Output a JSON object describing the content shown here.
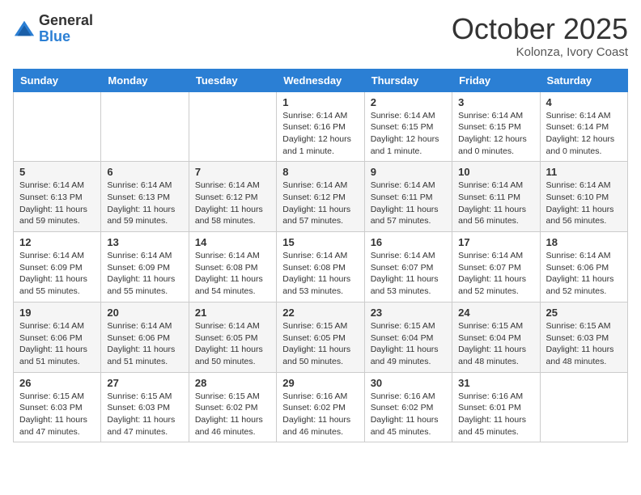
{
  "logo": {
    "general": "General",
    "blue": "Blue"
  },
  "title": "October 2025",
  "subtitle": "Kolonza, Ivory Coast",
  "days_of_week": [
    "Sunday",
    "Monday",
    "Tuesday",
    "Wednesday",
    "Thursday",
    "Friday",
    "Saturday"
  ],
  "weeks": [
    [
      {
        "day": "",
        "info": ""
      },
      {
        "day": "",
        "info": ""
      },
      {
        "day": "",
        "info": ""
      },
      {
        "day": "1",
        "info": "Sunrise: 6:14 AM\nSunset: 6:16 PM\nDaylight: 12 hours and 1 minute."
      },
      {
        "day": "2",
        "info": "Sunrise: 6:14 AM\nSunset: 6:15 PM\nDaylight: 12 hours and 1 minute."
      },
      {
        "day": "3",
        "info": "Sunrise: 6:14 AM\nSunset: 6:15 PM\nDaylight: 12 hours and 0 minutes."
      },
      {
        "day": "4",
        "info": "Sunrise: 6:14 AM\nSunset: 6:14 PM\nDaylight: 12 hours and 0 minutes."
      }
    ],
    [
      {
        "day": "5",
        "info": "Sunrise: 6:14 AM\nSunset: 6:13 PM\nDaylight: 11 hours and 59 minutes."
      },
      {
        "day": "6",
        "info": "Sunrise: 6:14 AM\nSunset: 6:13 PM\nDaylight: 11 hours and 59 minutes."
      },
      {
        "day": "7",
        "info": "Sunrise: 6:14 AM\nSunset: 6:12 PM\nDaylight: 11 hours and 58 minutes."
      },
      {
        "day": "8",
        "info": "Sunrise: 6:14 AM\nSunset: 6:12 PM\nDaylight: 11 hours and 57 minutes."
      },
      {
        "day": "9",
        "info": "Sunrise: 6:14 AM\nSunset: 6:11 PM\nDaylight: 11 hours and 57 minutes."
      },
      {
        "day": "10",
        "info": "Sunrise: 6:14 AM\nSunset: 6:11 PM\nDaylight: 11 hours and 56 minutes."
      },
      {
        "day": "11",
        "info": "Sunrise: 6:14 AM\nSunset: 6:10 PM\nDaylight: 11 hours and 56 minutes."
      }
    ],
    [
      {
        "day": "12",
        "info": "Sunrise: 6:14 AM\nSunset: 6:09 PM\nDaylight: 11 hours and 55 minutes."
      },
      {
        "day": "13",
        "info": "Sunrise: 6:14 AM\nSunset: 6:09 PM\nDaylight: 11 hours and 55 minutes."
      },
      {
        "day": "14",
        "info": "Sunrise: 6:14 AM\nSunset: 6:08 PM\nDaylight: 11 hours and 54 minutes."
      },
      {
        "day": "15",
        "info": "Sunrise: 6:14 AM\nSunset: 6:08 PM\nDaylight: 11 hours and 53 minutes."
      },
      {
        "day": "16",
        "info": "Sunrise: 6:14 AM\nSunset: 6:07 PM\nDaylight: 11 hours and 53 minutes."
      },
      {
        "day": "17",
        "info": "Sunrise: 6:14 AM\nSunset: 6:07 PM\nDaylight: 11 hours and 52 minutes."
      },
      {
        "day": "18",
        "info": "Sunrise: 6:14 AM\nSunset: 6:06 PM\nDaylight: 11 hours and 52 minutes."
      }
    ],
    [
      {
        "day": "19",
        "info": "Sunrise: 6:14 AM\nSunset: 6:06 PM\nDaylight: 11 hours and 51 minutes."
      },
      {
        "day": "20",
        "info": "Sunrise: 6:14 AM\nSunset: 6:06 PM\nDaylight: 11 hours and 51 minutes."
      },
      {
        "day": "21",
        "info": "Sunrise: 6:14 AM\nSunset: 6:05 PM\nDaylight: 11 hours and 50 minutes."
      },
      {
        "day": "22",
        "info": "Sunrise: 6:15 AM\nSunset: 6:05 PM\nDaylight: 11 hours and 50 minutes."
      },
      {
        "day": "23",
        "info": "Sunrise: 6:15 AM\nSunset: 6:04 PM\nDaylight: 11 hours and 49 minutes."
      },
      {
        "day": "24",
        "info": "Sunrise: 6:15 AM\nSunset: 6:04 PM\nDaylight: 11 hours and 48 minutes."
      },
      {
        "day": "25",
        "info": "Sunrise: 6:15 AM\nSunset: 6:03 PM\nDaylight: 11 hours and 48 minutes."
      }
    ],
    [
      {
        "day": "26",
        "info": "Sunrise: 6:15 AM\nSunset: 6:03 PM\nDaylight: 11 hours and 47 minutes."
      },
      {
        "day": "27",
        "info": "Sunrise: 6:15 AM\nSunset: 6:03 PM\nDaylight: 11 hours and 47 minutes."
      },
      {
        "day": "28",
        "info": "Sunrise: 6:15 AM\nSunset: 6:02 PM\nDaylight: 11 hours and 46 minutes."
      },
      {
        "day": "29",
        "info": "Sunrise: 6:16 AM\nSunset: 6:02 PM\nDaylight: 11 hours and 46 minutes."
      },
      {
        "day": "30",
        "info": "Sunrise: 6:16 AM\nSunset: 6:02 PM\nDaylight: 11 hours and 45 minutes."
      },
      {
        "day": "31",
        "info": "Sunrise: 6:16 AM\nSunset: 6:01 PM\nDaylight: 11 hours and 45 minutes."
      },
      {
        "day": "",
        "info": ""
      }
    ]
  ]
}
